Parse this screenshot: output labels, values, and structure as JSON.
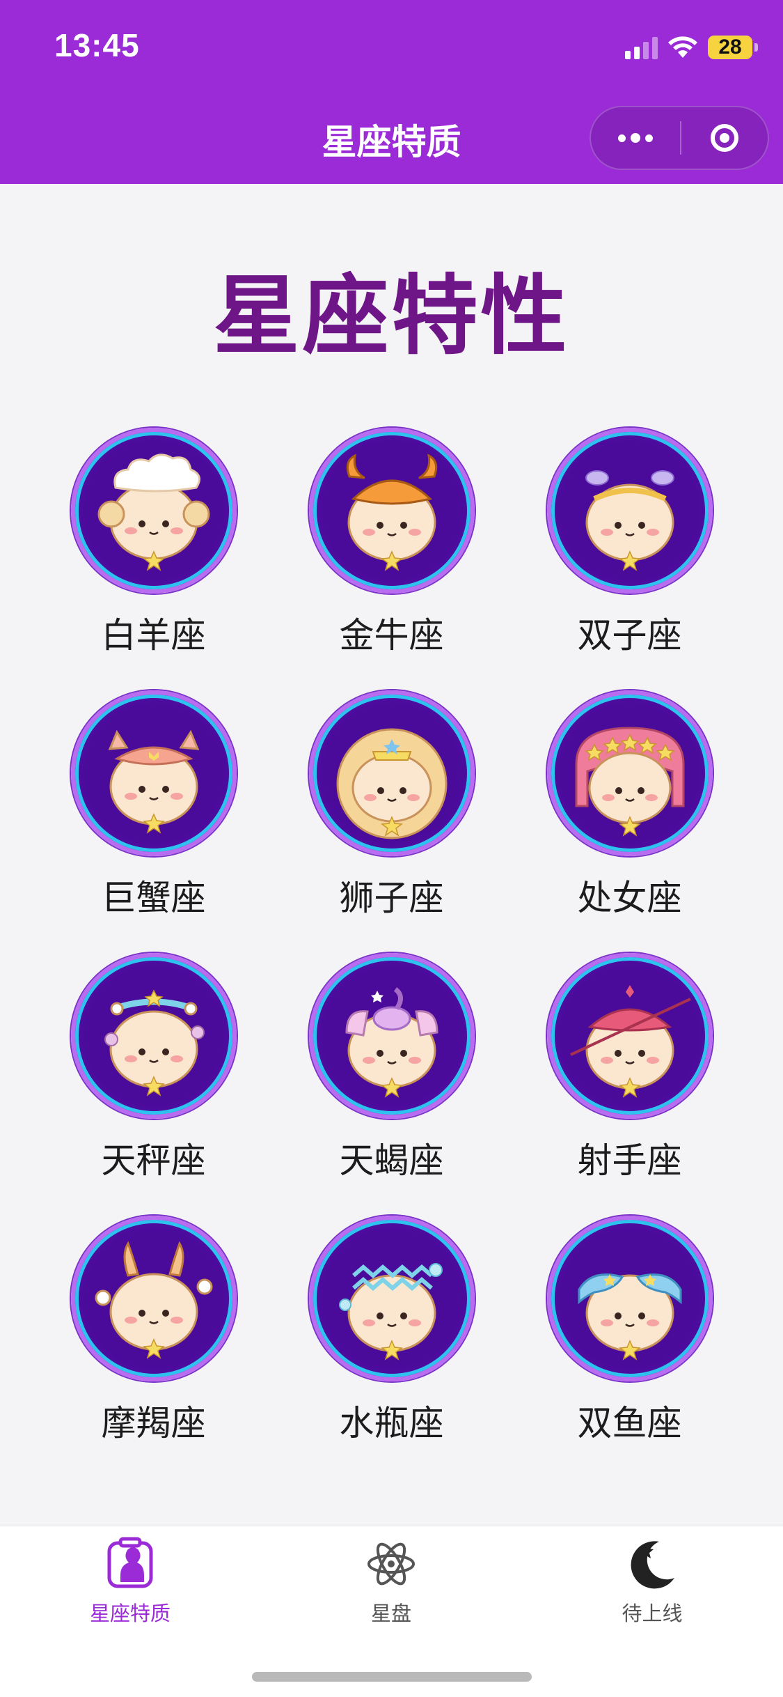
{
  "status_bar": {
    "time": "13:45",
    "battery": "28"
  },
  "nav": {
    "title": "星座特质"
  },
  "main": {
    "title": "星座特性",
    "signs": [
      {
        "name": "白羊座",
        "icon": "aries-mascot-icon"
      },
      {
        "name": "金牛座",
        "icon": "taurus-mascot-icon"
      },
      {
        "name": "双子座",
        "icon": "gemini-mascot-icon"
      },
      {
        "name": "巨蟹座",
        "icon": "cancer-mascot-icon"
      },
      {
        "name": "狮子座",
        "icon": "leo-mascot-icon"
      },
      {
        "name": "处女座",
        "icon": "virgo-mascot-icon"
      },
      {
        "name": "天秤座",
        "icon": "libra-mascot-icon"
      },
      {
        "name": "天蝎座",
        "icon": "scorpio-mascot-icon"
      },
      {
        "name": "射手座",
        "icon": "sagittarius-mascot-icon"
      },
      {
        "name": "摩羯座",
        "icon": "capricorn-mascot-icon"
      },
      {
        "name": "水瓶座",
        "icon": "aquarius-mascot-icon"
      },
      {
        "name": "双鱼座",
        "icon": "pisces-mascot-icon"
      }
    ]
  },
  "tabbar": {
    "items": [
      {
        "label": "星座特质",
        "icon": "zodiac-profile-icon",
        "active": true
      },
      {
        "label": "星盘",
        "icon": "atom-orbit-icon",
        "active": false
      },
      {
        "label": "待上线",
        "icon": "moon-star-icon",
        "active": false
      }
    ]
  },
  "colors": {
    "header": "#9a2bd6",
    "title": "#6e1587",
    "avatar_bg": "#4a0a9a",
    "avatar_ring": "#2ec3ef",
    "tab_active": "#9a2bd6"
  }
}
